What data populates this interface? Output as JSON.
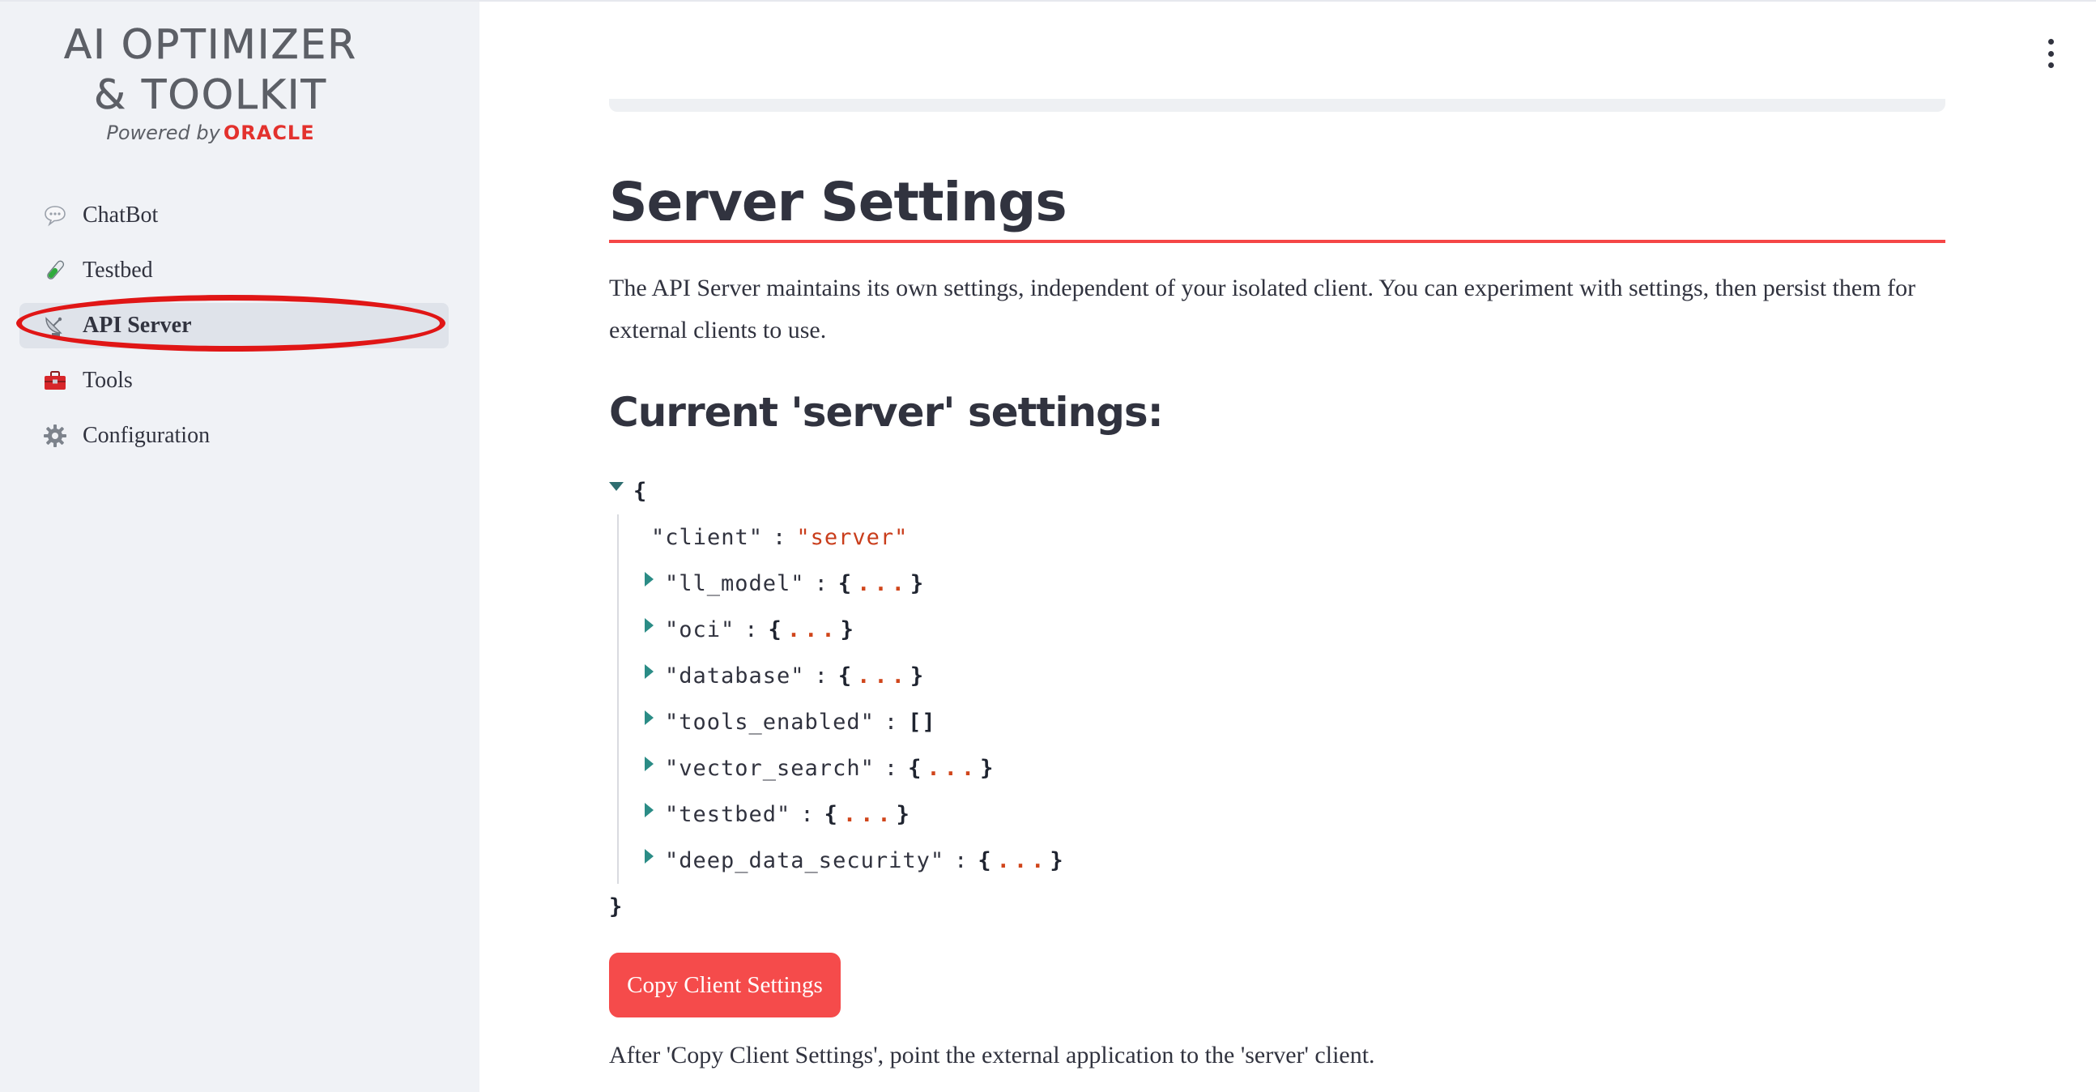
{
  "logo": {
    "line1": "AI OPTIMIZER",
    "line2": "& TOOLKIT",
    "powered_by": "Powered by",
    "brand": "ORACLE"
  },
  "nav": {
    "items": [
      {
        "label": "ChatBot",
        "icon": "speech-bubble-icon",
        "active": false
      },
      {
        "label": "Testbed",
        "icon": "test-tube-icon",
        "active": false
      },
      {
        "label": "API Server",
        "icon": "satellite-antenna-icon",
        "active": true
      },
      {
        "label": "Tools",
        "icon": "toolbox-icon",
        "active": false
      },
      {
        "label": "Configuration",
        "icon": "gear-icon",
        "active": false
      }
    ]
  },
  "page": {
    "title": "Server Settings",
    "description": "The API Server maintains its own settings, independent of your isolated client. You can experiment with settings, then persist them for external clients to use.",
    "subtitle": "Current 'server' settings:"
  },
  "json_tree": {
    "open_brace": "{",
    "close_brace": "}",
    "client_key": "\"client\"",
    "client_value": "\"server\"",
    "nodes": [
      {
        "key": "\"ll_model\"",
        "open": "{",
        "ellipsis": "...",
        "close": "}"
      },
      {
        "key": "\"oci\"",
        "open": "{",
        "ellipsis": "...",
        "close": "}"
      },
      {
        "key": "\"database\"",
        "open": "{",
        "ellipsis": "...",
        "close": "}"
      },
      {
        "key": "\"tools_enabled\"",
        "value": "[]"
      },
      {
        "key": "\"vector_search\"",
        "open": "{",
        "ellipsis": "...",
        "close": "}"
      },
      {
        "key": "\"testbed\"",
        "open": "{",
        "ellipsis": "...",
        "close": "}"
      },
      {
        "key": "\"deep_data_security\"",
        "open": "{",
        "ellipsis": "...",
        "close": "}"
      }
    ]
  },
  "actions": {
    "copy_button": "Copy Client Settings"
  },
  "footer_text": "After 'Copy Client Settings', point the external application to the 'server' client.",
  "colors": {
    "accent": "#f54b4b",
    "highlight_ring": "#e01616",
    "sidebar_bg": "#f0f2f6",
    "json_string": "#c93d1b"
  }
}
